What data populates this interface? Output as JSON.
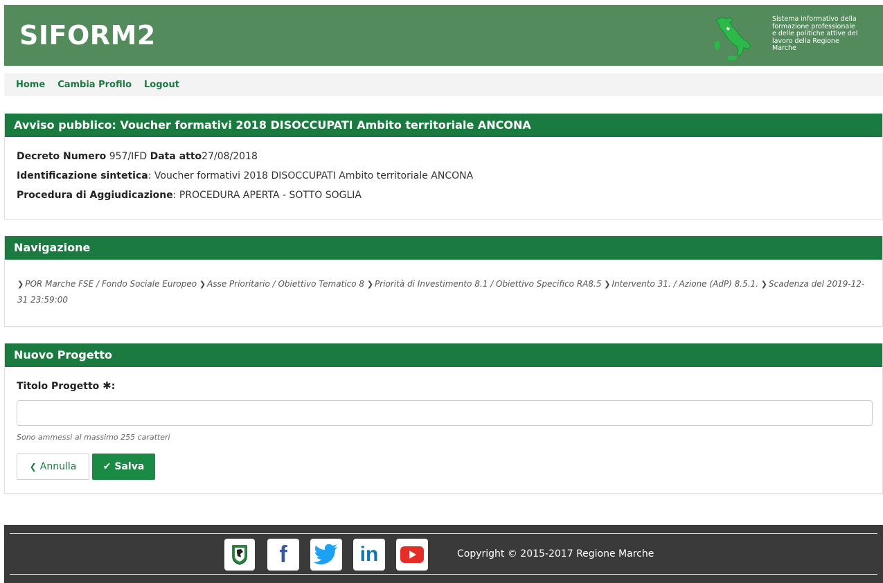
{
  "header": {
    "brand": "SIFORM2",
    "description": "Sistema informativo della\nformazione professionale\ne delle politiche attive del\nlavoro della Regione\nMarche"
  },
  "nav": {
    "home": "Home",
    "change_profile": "Cambia Profilo",
    "logout": "Logout"
  },
  "notice": {
    "title": "Avviso pubblico: Voucher formativi 2018 DISOCCUPATI Ambito territoriale ANCONA",
    "decree_label": "Decreto Numero",
    "decree_value": " 957/IFD ",
    "date_label": "Data atto",
    "date_value": "27/08/2018",
    "summary_label": "Identificazione sintetica",
    "summary_value": ": Voucher formativi 2018 DISOCCUPATI Ambito territoriale ANCONA",
    "procedure_label": "Procedura di Aggiudicazione",
    "procedure_value": ": PROCEDURA APERTA - SOTTO SOGLIA"
  },
  "navigation": {
    "title": "Navigazione",
    "crumbs": [
      "POR Marche FSE / Fondo Sociale Europeo",
      "Asse Prioritario / Obiettivo Tematico 8",
      "Priorità di Investimento 8.1 / Obiettivo Specifico RA8.5",
      "Intervento 31. / Azione (AdP) 8.5.1.",
      "Scadenza del 2019-12-31 23:59:00"
    ]
  },
  "project_form": {
    "title": "Nuovo Progetto",
    "field_label": "Titolo Progetto",
    "required_mark": "✱",
    "field_suffix": ":",
    "field_value": "",
    "help_text": "Sono ammessi al massimo 255 caratteri",
    "cancel_label": "Annulla",
    "save_label": "Salva"
  },
  "footer": {
    "copyright": "Copyright © 2015-2017 Regione Marche",
    "icons": [
      "regione-marche-logo-icon",
      "facebook-icon",
      "twitter-icon",
      "linkedin-icon",
      "youtube-icon"
    ]
  },
  "colors": {
    "header_green": "#548b5c",
    "panel_green": "#1a7a40",
    "footer_dark": "#3a3a3a"
  }
}
